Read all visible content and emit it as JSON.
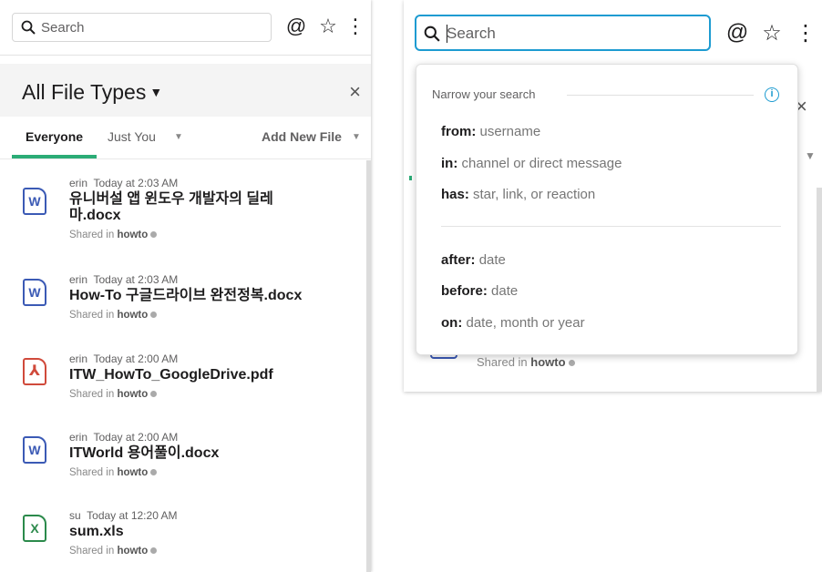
{
  "left": {
    "search_placeholder": "Search",
    "at_icon": "@",
    "star_icon": "☆",
    "more_icon": "⋮",
    "flex_title": "All File Types",
    "title_caret": "▼",
    "close": "×",
    "tabs": {
      "everyone": "Everyone",
      "just_you": "Just You",
      "just_you_caret": "▼",
      "add_new": "Add New File",
      "add_new_caret": "▼"
    },
    "files": [
      {
        "icon_type": "word",
        "icon_glyph": "W",
        "user": "erin",
        "time": "Today at 2:03 AM",
        "name": "유니버설 앱 윈도우 개발자의 딜레마.docx",
        "shared_prefix": "Shared in",
        "channel": "howto"
      },
      {
        "icon_type": "word",
        "icon_glyph": "W",
        "user": "erin",
        "time": "Today at 2:03 AM",
        "name": "How-To 구글드라이브 완전정복.docx",
        "shared_prefix": "Shared in",
        "channel": "howto"
      },
      {
        "icon_type": "pdf",
        "icon_glyph": "⅄",
        "user": "erin",
        "time": "Today at 2:00 AM",
        "name": "ITW_HowTo_GoogleDrive.pdf",
        "shared_prefix": "Shared in",
        "channel": "howto"
      },
      {
        "icon_type": "word",
        "icon_glyph": "W",
        "user": "erin",
        "time": "Today at 2:00 AM",
        "name": "ITWorld 용어풀이.docx",
        "shared_prefix": "Shared in",
        "channel": "howto"
      },
      {
        "icon_type": "xls",
        "icon_glyph": "X",
        "user": "su",
        "time": "Today at 12:20 AM",
        "name": "sum.xls",
        "shared_prefix": "Shared in",
        "channel": "howto"
      }
    ]
  },
  "right": {
    "search_placeholder": "Search",
    "at_icon": "@",
    "star_icon": "☆",
    "more_icon": "⋮",
    "close": "×",
    "caret": "▼",
    "dropdown": {
      "heading": "Narrow your search",
      "info_icon": "i",
      "group1": [
        {
          "key": "from:",
          "value": "username"
        },
        {
          "key": "in:",
          "value": "channel or direct message"
        },
        {
          "key": "has:",
          "value": "star, link, or reaction"
        }
      ],
      "group2": [
        {
          "key": "after:",
          "value": "date"
        },
        {
          "key": "before:",
          "value": "date"
        },
        {
          "key": "on:",
          "value": "date, month or year"
        }
      ]
    },
    "peek_shared_prefix": "Shared in",
    "peek_channel": "howto"
  },
  "colors": {
    "accent_green": "#2bac76",
    "focus_blue": "#1d9bd1",
    "word_blue": "#3b5ab5",
    "pdf_red": "#d04a3b",
    "xls_green": "#2b8a4b"
  }
}
